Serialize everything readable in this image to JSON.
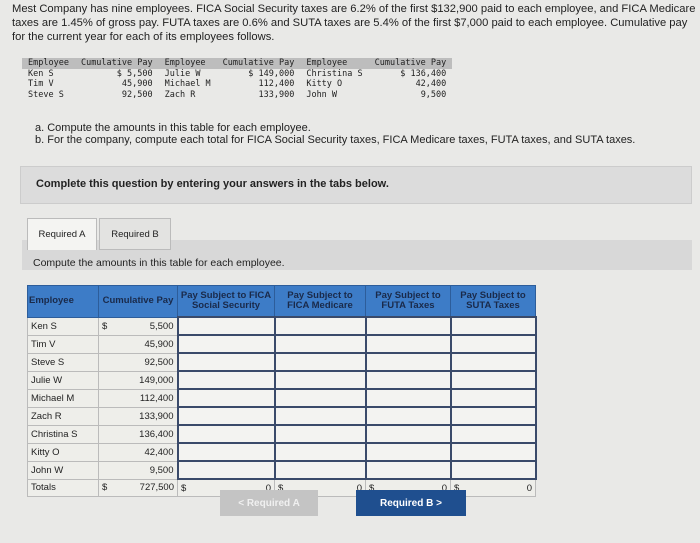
{
  "intro": "Mest Company has nine employees. FICA Social Security taxes are 6.2% of the first $132,900 paid to each employee, and FICA Medicare taxes are 1.45% of gross pay. FUTA taxes are 0.6% and SUTA taxes are 5.4% of the first $7,000 paid to each employee. Cumulative pay for the current year for each of its employees follows.",
  "given": {
    "headers": [
      "Employee",
      "Cumulative Pay",
      "Employee",
      "Cumulative Pay",
      "Employee",
      "Cumulative Pay"
    ],
    "rows": [
      [
        "Ken S",
        "$ 5,500",
        "Julie W",
        "$ 149,000",
        "Christina S",
        "$ 136,400"
      ],
      [
        "Tim V",
        "45,900",
        "Michael M",
        "112,400",
        "Kitty O",
        "42,400"
      ],
      [
        "Steve S",
        "92,500",
        "Zach R",
        "133,900",
        "John W",
        "9,500"
      ]
    ]
  },
  "tasks": {
    "a": "a. Compute the amounts in this table for each employee.",
    "b": "b. For the company, compute each total for FICA Social Security taxes, FICA Medicare taxes, FUTA taxes, and SUTA taxes."
  },
  "instruction": "Complete this question by entering your answers in the tabs below.",
  "tabs": [
    "Required A",
    "Required B"
  ],
  "panel_title": "Compute the amounts in this table for each employee.",
  "table": {
    "headers": [
      "Employee",
      "Cumulative Pay",
      "Pay Subject to FICA Social Security",
      "Pay Subject to FICA Medicare",
      "Pay Subject to FUTA Taxes",
      "Pay Subject to SUTA Taxes"
    ],
    "rows": [
      [
        "Ken S",
        "$",
        "5,500"
      ],
      [
        "Tim V",
        "",
        "45,900"
      ],
      [
        "Steve S",
        "",
        "92,500"
      ],
      [
        "Julie W",
        "",
        "149,000"
      ],
      [
        "Michael M",
        "",
        "112,400"
      ],
      [
        "Zach R",
        "",
        "133,900"
      ],
      [
        "Christina S",
        "",
        "136,400"
      ],
      [
        "Kitty O",
        "",
        "42,400"
      ],
      [
        "John W",
        "",
        "9,500"
      ]
    ],
    "totals": {
      "label": "Totals",
      "currency": "$",
      "cumulative": "727,500",
      "fica_ss": "0",
      "medicare": "0",
      "futa": "0",
      "suta": "0"
    }
  },
  "nav": {
    "prev": "< Required A",
    "next": "Required B  >"
  },
  "colors": {
    "header_blue": "#3d7cc7",
    "button_blue": "#1f4f8f"
  }
}
